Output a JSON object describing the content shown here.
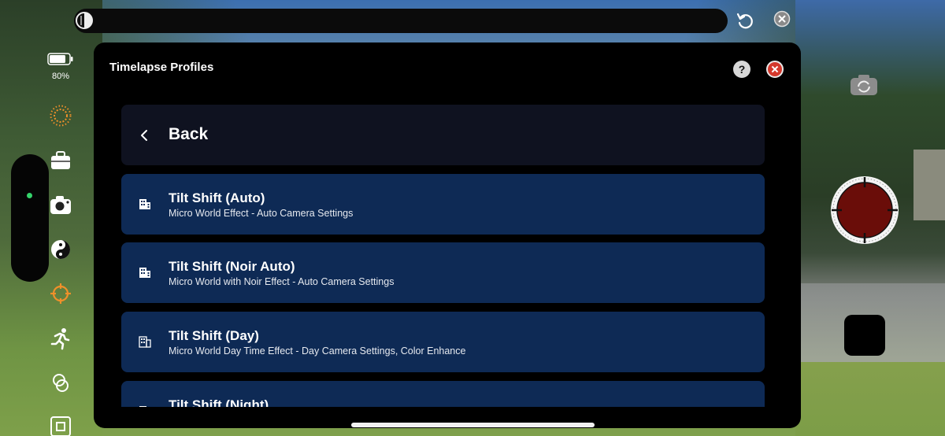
{
  "status": {
    "battery_percent_label": "80%",
    "battery_level": 0.8
  },
  "modal": {
    "title": "Timelapse Profiles",
    "help_label": "?",
    "back_label": "Back",
    "items": [
      {
        "title": "Tilt Shift (Auto)",
        "subtitle": "Micro World Effect - Auto Camera Settings",
        "icon": "building-icon"
      },
      {
        "title": "Tilt Shift (Noir Auto)",
        "subtitle": "Micro World with Noir Effect - Auto Camera Settings",
        "icon": "building-icon"
      },
      {
        "title": "Tilt Shift (Day)",
        "subtitle": "Micro World Day Time Effect - Day Camera Settings, Color Enhance",
        "icon": "building-icon"
      },
      {
        "title": "Tilt Shift (Night)",
        "subtitle": "",
        "icon": "building-icon"
      }
    ]
  },
  "sidebar_icons": [
    "exposure-sun-icon",
    "briefcase-icon",
    "camera-settings-icon",
    "yin-yang-filter-icon",
    "focus-target-icon",
    "running-person-icon",
    "overlap-circles-icon",
    "grid-focus-icon"
  ],
  "colors": {
    "modal_bg": "#000000",
    "item_bg": "#0e2a55",
    "back_row_bg": "#0f1220",
    "accent_orange": "#f0902a",
    "close_red": "#d4382c",
    "shutter_red": "#6a0d09",
    "status_green": "#35d36b"
  }
}
